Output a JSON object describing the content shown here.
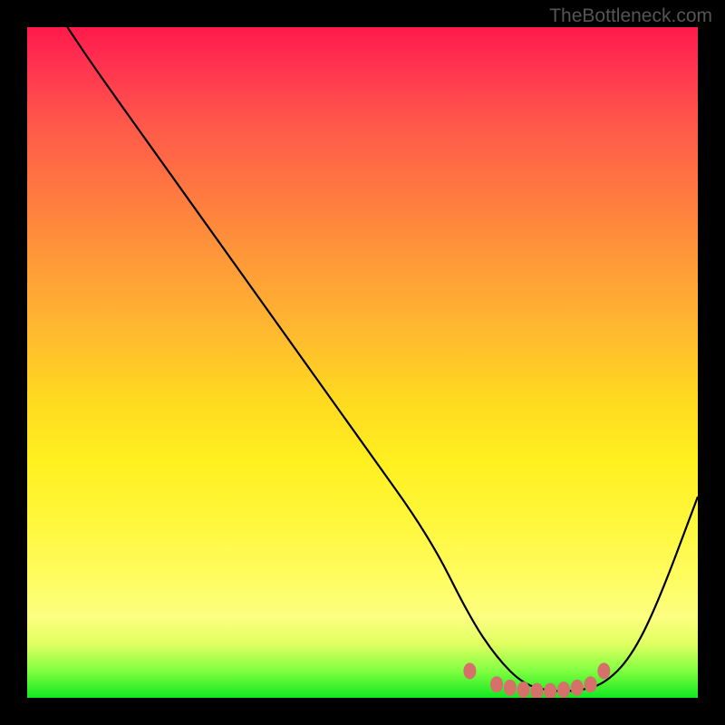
{
  "watermark": "TheBottleneck.com",
  "chart_data": {
    "type": "line",
    "title": "",
    "xlabel": "",
    "ylabel": "",
    "xlim": [
      0,
      100
    ],
    "ylim": [
      0,
      100
    ],
    "series": [
      {
        "name": "curve",
        "x": [
          6,
          10,
          20,
          30,
          40,
          50,
          60,
          66,
          70,
          74,
          78,
          82,
          86,
          90,
          94,
          100
        ],
        "y": [
          100,
          94,
          80,
          66,
          52,
          38,
          24,
          12,
          6,
          2,
          1,
          1,
          2,
          6,
          14,
          30
        ],
        "color": "#000000"
      },
      {
        "name": "dots",
        "type": "scatter",
        "x": [
          66,
          70,
          72,
          74,
          76,
          78,
          80,
          82,
          84,
          86
        ],
        "y": [
          4,
          2,
          1.5,
          1.2,
          1,
          1,
          1.2,
          1.5,
          2,
          4
        ],
        "color": "#d6706a"
      }
    ],
    "background_gradient": {
      "top": "#ff1a4a",
      "mid": "#fff020",
      "bottom": "#10e820"
    }
  }
}
